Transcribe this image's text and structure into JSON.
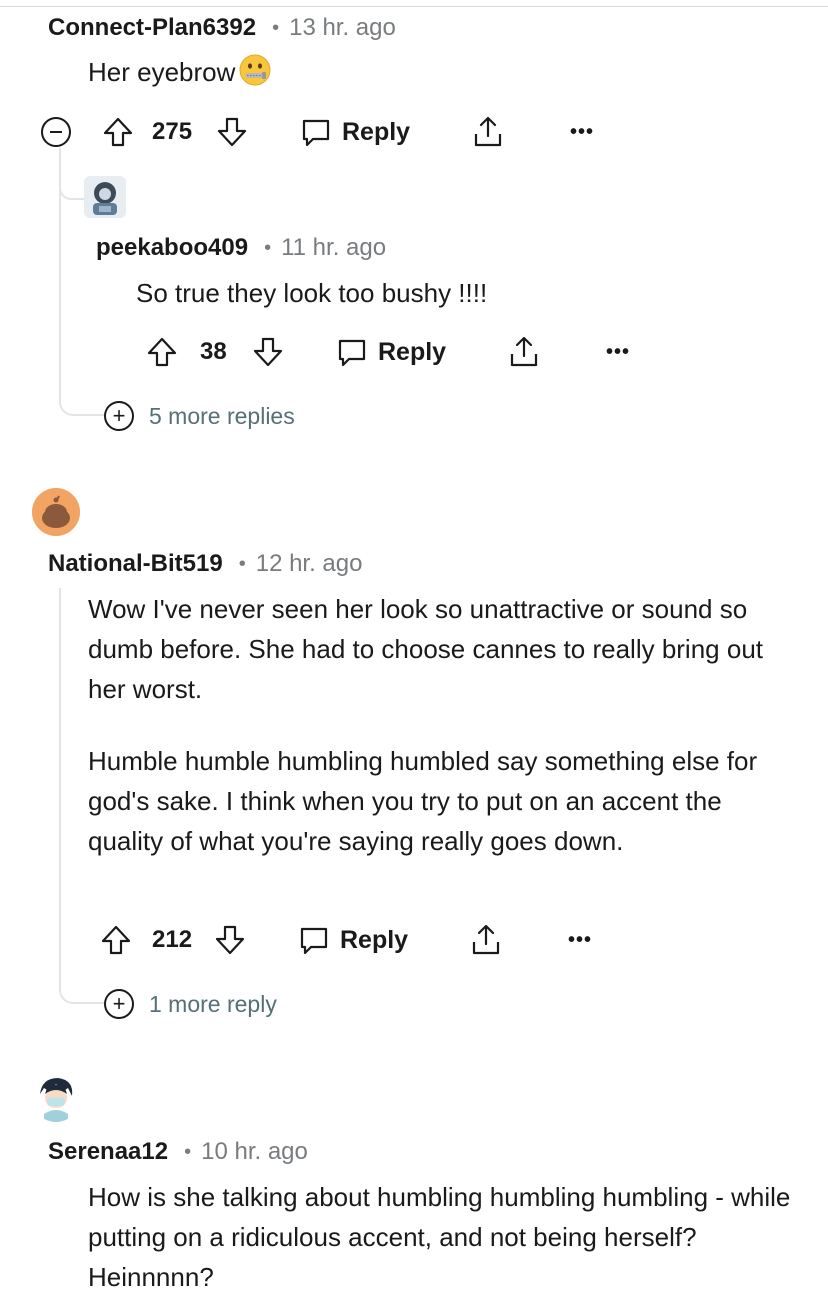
{
  "comments": [
    {
      "username": "Connect-Plan6392",
      "time": "13 hr. ago",
      "body": [
        "Her eyebrow"
      ],
      "emoji": "zipper-mouth-face",
      "score": "275",
      "reply_label": "Reply",
      "more_label": "•••",
      "replies": [
        {
          "username": "peekaboo409",
          "time": "11 hr. ago",
          "body": [
            "So true they look too bushy !!!!"
          ],
          "score": "38",
          "reply_label": "Reply",
          "more_label": "•••"
        }
      ],
      "more_replies": "5 more replies"
    },
    {
      "username": "National-Bit519",
      "time": "12 hr. ago",
      "body": [
        "Wow I've never seen her look so unattractive or sound so dumb before. She had to choose cannes to really bring out her worst.",
        "Humble humble humbling humbled say something else for god's sake. I think when you try to put on an accent the quality of what you're saying really goes down."
      ],
      "score": "212",
      "reply_label": "Reply",
      "more_label": "•••",
      "more_replies": "1 more reply"
    },
    {
      "username": "Serenaa12",
      "time": "10 hr. ago",
      "body": [
        "How is she talking about humbling humbling humbling - while putting on a ridiculous accent, and not being herself? Heinnnnn?"
      ]
    }
  ],
  "separator": "•",
  "colors": {
    "text": "#1a1a1b",
    "meta": "#787c7e",
    "thread": "#e2e5e8",
    "link": "#576f76"
  },
  "icons": [
    "collapse-icon",
    "upvote-icon",
    "downvote-icon",
    "comment-icon",
    "share-icon",
    "overflow-icon",
    "expand-icon",
    "avatar"
  ]
}
